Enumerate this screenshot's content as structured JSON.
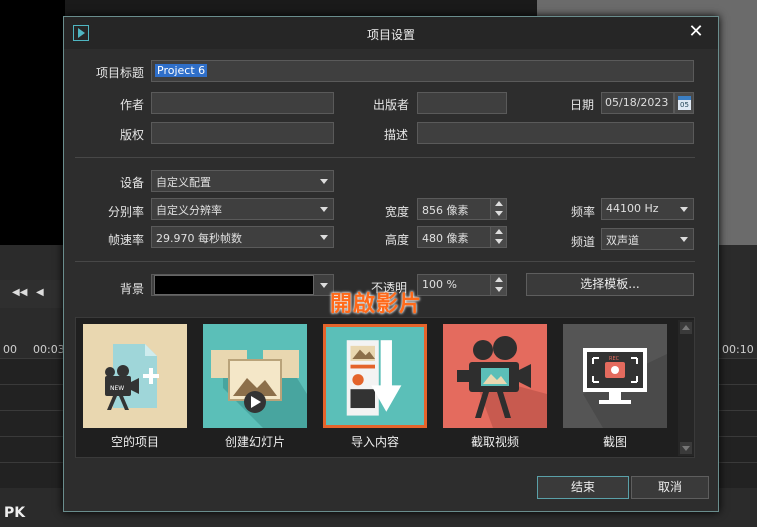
{
  "dialog": {
    "title": "项目设置",
    "close_symbol": "✕"
  },
  "project": {
    "title_label": "项目标题",
    "title_value": "Project 6",
    "author_label": "作者",
    "author_value": "",
    "publisher_label": "出版者",
    "publisher_value": "",
    "date_label": "日期",
    "date_value": "05/18/2023",
    "calendar_day": "05",
    "copyright_label": "版权",
    "copyright_value": "",
    "description_label": "描述",
    "description_value": ""
  },
  "device": {
    "device_label": "设备",
    "device_value": "自定义配置",
    "resolution_label": "分别率",
    "resolution_value": "自定义分辨率",
    "framerate_label": "帧速率",
    "framerate_value": "29.970 每秒帧数",
    "width_label": "宽度",
    "width_value": "856 像素",
    "height_label": "高度",
    "height_value": "480 像素",
    "frequency_label": "频率",
    "frequency_value": "44100 Hz",
    "channel_label": "频道",
    "channel_value": "双声道"
  },
  "background": {
    "label": "背景",
    "color": "#000000",
    "opacity_label": "不透明",
    "opacity_value": "100 %",
    "template_button": "选择模板..."
  },
  "templates": [
    {
      "label": "空的项目"
    },
    {
      "label": "创建幻灯片"
    },
    {
      "label": "导入内容"
    },
    {
      "label": "截取视频"
    },
    {
      "label": "截图"
    }
  ],
  "annotation": "開啟影片",
  "buttons": {
    "ok": "结束",
    "cancel": "取消"
  },
  "timeline": {
    "ruler_left": "00",
    "ruler_left2": "00:03",
    "ruler_right": "00:10"
  },
  "watermark": "PK",
  "colors": {
    "accent": "#4fb6c2",
    "selection": "#e4642b",
    "annotation": "#ff6a1a"
  }
}
